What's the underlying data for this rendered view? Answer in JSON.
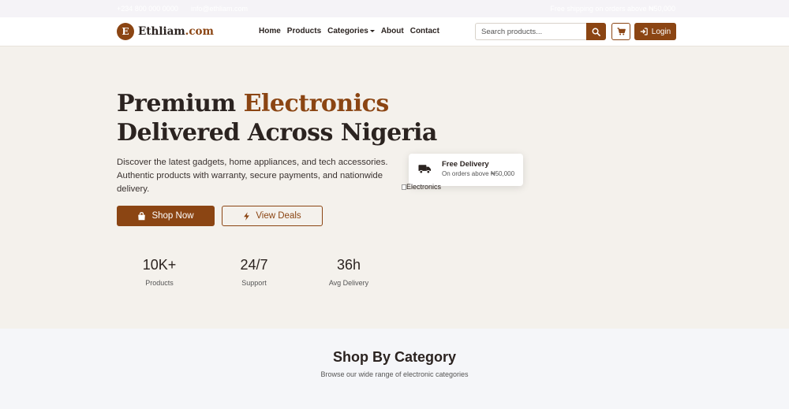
{
  "topbar": {
    "phone": "+234 800 000 0000",
    "email": "info@ethliam.com",
    "notice": "Free shipping on orders above ₦50,000"
  },
  "brand": {
    "badge": "E",
    "name": "Ethliam",
    "tld": ".com"
  },
  "nav": {
    "items": [
      {
        "label": "Home"
      },
      {
        "label": "Products"
      },
      {
        "label": "Categories"
      },
      {
        "label": "About"
      },
      {
        "label": "Contact"
      }
    ]
  },
  "search": {
    "placeholder": "Search products..."
  },
  "actions": {
    "login_label": "Login"
  },
  "hero": {
    "title_line1_plain": "Premium ",
    "title_line1_accent": "Electronics",
    "title_line2": "Delivered Across Nigeria",
    "description": "Discover the latest gadgets, home appliances, and tech accessories. Authentic products with warranty, secure payments, and nationwide delivery.",
    "shop_button": "Shop Now",
    "deals_button": "View Deals",
    "image_alt": "Electronics"
  },
  "stats": [
    {
      "value": "10K+",
      "label": "Products"
    },
    {
      "value": "24/7",
      "label": "Support"
    },
    {
      "value": "36h",
      "label": "Avg Delivery"
    }
  ],
  "delivery_card": {
    "title": "Free Delivery",
    "subtitle": "On orders above ₦50,000"
  },
  "category_section": {
    "title": "Shop By Category",
    "subtitle": "Browse our wide range of electronic categories"
  },
  "colors": {
    "brand": "#8b4513",
    "hero_bg": "#f4f1ec",
    "section_bg": "#f5f6f9",
    "text": "#2b2320"
  }
}
